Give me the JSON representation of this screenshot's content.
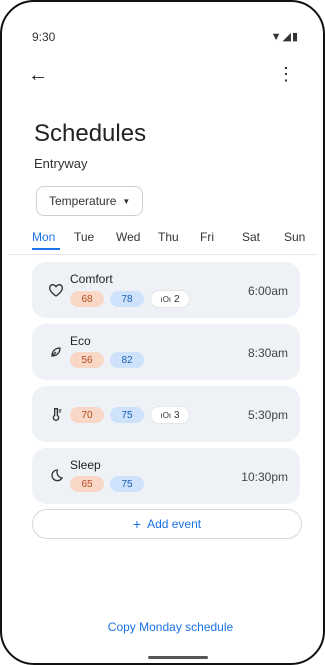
{
  "status_bar": {
    "time": "9:30",
    "icons": "▼◢▮"
  },
  "app_bar": {
    "back_icon": "←",
    "more_icon": "⋮"
  },
  "header": {
    "title": "Schedules",
    "subtitle": "Entryway"
  },
  "filter": {
    "label": "Temperature",
    "caret": "▼"
  },
  "tabs": [
    {
      "label": "Mon",
      "active": true
    },
    {
      "label": "Tue",
      "active": false
    },
    {
      "label": "Wed",
      "active": false
    },
    {
      "label": "Thu",
      "active": false
    },
    {
      "label": "Fri",
      "active": false
    },
    {
      "label": "Sat",
      "active": false
    },
    {
      "label": "Sun",
      "active": false
    }
  ],
  "events": [
    {
      "name": "Comfort",
      "icon": "heart-icon",
      "heat": "68",
      "cool": "78",
      "people": "2",
      "time": "6:00am"
    },
    {
      "name": "Eco",
      "icon": "eco-icon",
      "heat": "56",
      "cool": "82",
      "people": "",
      "time": "8:30am"
    },
    {
      "name": "",
      "icon": "thermometer-icon",
      "heat": "70",
      "cool": "75",
      "people": "3",
      "time": "5:30pm"
    },
    {
      "name": "Sleep",
      "icon": "moon-icon",
      "heat": "65",
      "cool": "75",
      "people": "",
      "time": "10:30pm"
    }
  ],
  "actions": {
    "add_event": "Add event",
    "copy_schedule": "Copy Monday schedule"
  },
  "colors": {
    "accent": "#1a73e8",
    "card_bg": "#eef2f7",
    "heat_bg": "#f8d7c7",
    "cool_bg": "#cfe2fb"
  }
}
